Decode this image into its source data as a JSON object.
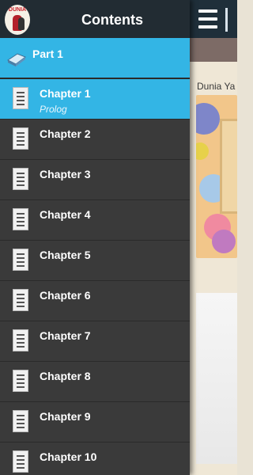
{
  "app": {
    "logo_text": "DUNIA"
  },
  "drawer": {
    "title": "Contents",
    "part": {
      "label": "Part 1",
      "icon": "book-icon"
    },
    "chapters": [
      {
        "label": "Chapter 1",
        "subtitle": "Prolog",
        "selected": true,
        "icon": "document-icon"
      },
      {
        "label": "Chapter 2",
        "icon": "document-icon"
      },
      {
        "label": "Chapter 3",
        "icon": "document-icon"
      },
      {
        "label": "Chapter 4",
        "icon": "document-icon"
      },
      {
        "label": "Chapter 5",
        "icon": "document-icon"
      },
      {
        "label": "Chapter 6",
        "icon": "document-icon"
      },
      {
        "label": "Chapter 7",
        "icon": "document-icon"
      },
      {
        "label": "Chapter 8",
        "icon": "document-icon"
      },
      {
        "label": "Chapter 9",
        "icon": "document-icon"
      },
      {
        "label": "Chapter 10",
        "icon": "document-icon"
      }
    ]
  },
  "main": {
    "book_title": "Dunia Ya",
    "menu_icon": "hamburger-menu-icon"
  },
  "colors": {
    "accent": "#33b5e5",
    "drawer_bg": "#3a3a3a",
    "header_bg": "#222c33"
  }
}
